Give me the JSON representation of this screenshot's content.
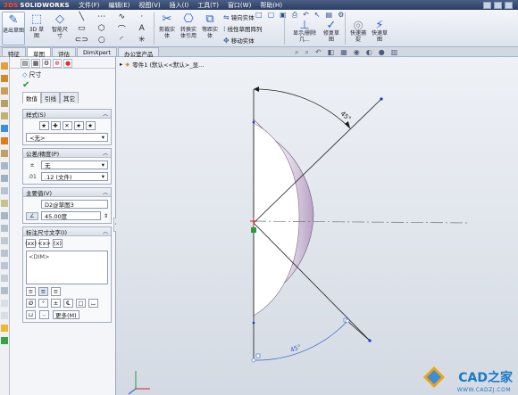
{
  "app": {
    "brand_ds": "3DS",
    "brand_name": "SOLIDWORKS"
  },
  "menu": [
    "文件(F)",
    "编辑(E)",
    "视图(V)",
    "插入(I)",
    "工具(T)",
    "窗口(W)",
    "帮助(H)"
  ],
  "ribbon": {
    "exit_sketch": "退出草图",
    "sketch3d": "3D 草图",
    "smart_dim": "智能尺寸",
    "trim": "剪裁实体",
    "convert": "转换实体引用",
    "offset": "等距实体",
    "mirror": "镜向实体",
    "linear_pattern": "线性草图阵列",
    "move": "移动实体",
    "display_delete": "显示/删除几...",
    "repair": "修复草图",
    "quick_snap": "快速捕捉",
    "rapid_sketch": "快速草图"
  },
  "tabs": [
    "特征",
    "草图",
    "评估",
    "DimXpert",
    "办公室产品"
  ],
  "tree": {
    "label": "零件1 (默认<<默认>_显..."
  },
  "pm": {
    "title": "尺寸",
    "tabs": [
      "数值",
      "引线",
      "其它"
    ],
    "style": {
      "header": "样式(S)",
      "value": "<无>"
    },
    "tolerance": {
      "header": "公差/精度(P)",
      "tolerance_value": "无",
      "precision_value": ".12 (文件)"
    },
    "primary": {
      "header": "主要值(V)",
      "name": "D2@草图3",
      "value": "45.00度"
    },
    "dim_text": {
      "header": "标注尺寸文字(I)",
      "content": "<DIM>",
      "more": "更多(M)"
    }
  },
  "dims": {
    "top": "45°",
    "bottom": "45°"
  },
  "watermark": {
    "main": "CAD之家",
    "sub": "WWW.CADZJ.COM"
  },
  "colors": {
    "accent": "#1c5fc0",
    "sketch": "#1b2fd0",
    "sphere": "#cbb9d4"
  }
}
